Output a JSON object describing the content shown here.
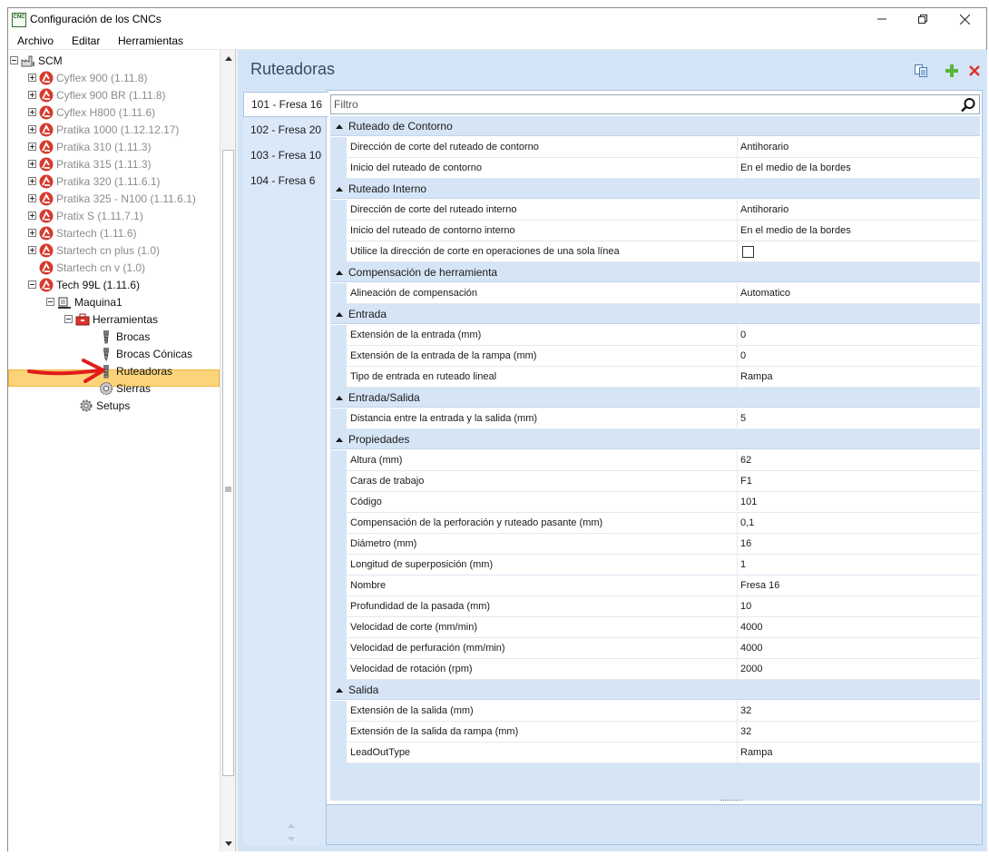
{
  "window": {
    "icon_text": "CNC",
    "title": "Configuración de los CNCs"
  },
  "menu": [
    "Archivo",
    "Editar",
    "Herramientas"
  ],
  "tree": {
    "root": "SCM",
    "machines": [
      {
        "label": "Cyflex 900 (1.11.8)",
        "active": false,
        "expandable": true
      },
      {
        "label": "Cyflex 900 BR (1.11.8)",
        "active": false,
        "expandable": true
      },
      {
        "label": "Cyflex H800 (1.11.6)",
        "active": false,
        "expandable": true
      },
      {
        "label": "Pratika 1000 (1.12.12.17)",
        "active": false,
        "expandable": true
      },
      {
        "label": "Pratika 310 (1.11.3)",
        "active": false,
        "expandable": true
      },
      {
        "label": "Pratika 315 (1.11.3)",
        "active": false,
        "expandable": true
      },
      {
        "label": "Pratika 320 (1.11.6.1)",
        "active": false,
        "expandable": true
      },
      {
        "label": "Pratika 325 - N100 (1.11.6.1)",
        "active": false,
        "expandable": true
      },
      {
        "label": "Pratix S (1.11.7.1)",
        "active": false,
        "expandable": true
      },
      {
        "label": "Startech (1.11.6)",
        "active": false,
        "expandable": true
      },
      {
        "label": "Startech cn plus (1.0)",
        "active": false,
        "expandable": true
      },
      {
        "label": "Startech cn v (1.0)",
        "active": false,
        "expandable": false
      },
      {
        "label": "Tech 99L (1.11.6)",
        "active": true,
        "expandable": true
      }
    ],
    "machine_node": "Maquina1",
    "tools_node": "Herramientas",
    "tool_types": [
      "Brocas",
      "Brocas Cónicas",
      "Ruteadoras",
      "Sierras"
    ],
    "selected": "Ruteadoras",
    "setups": "Setups"
  },
  "panel": {
    "title": "Ruteadoras",
    "toolbar": {
      "copy_icon": "copy-icon",
      "add_icon": "add-icon",
      "delete_icon": "delete-icon"
    },
    "tabs": [
      "101 - Fresa 16",
      "102 - Fresa 20",
      "103 - Fresa 10",
      "104 - Fresa 6"
    ],
    "active_tab": "101 - Fresa 16",
    "filter_placeholder": "Filtro"
  },
  "grid": {
    "categories": [
      {
        "name": "Ruteado de Contorno",
        "props": [
          {
            "name": "Dirección de corte del ruteado de contorno",
            "value": "Antihorario"
          },
          {
            "name": "Inicio del ruteado de contorno",
            "value": "En el medio de la bordes"
          }
        ]
      },
      {
        "name": "Ruteado Interno",
        "props": [
          {
            "name": "Dirección de corte del ruteado interno",
            "value": "Antihorario"
          },
          {
            "name": "Inicio del ruteado de contorno interno",
            "value": "En el medio de la bordes"
          },
          {
            "name": "Utilice la dirección de corte en operaciones de una sola línea",
            "value": "",
            "checkbox": true,
            "checked": false
          }
        ]
      },
      {
        "name": "Compensación de herramienta",
        "props": [
          {
            "name": "Alineación de compensación",
            "value": "Automatico"
          }
        ]
      },
      {
        "name": "Entrada",
        "props": [
          {
            "name": "Extensión de la entrada (mm)",
            "value": "0"
          },
          {
            "name": "Extensión de la entrada de la rampa (mm)",
            "value": "0"
          },
          {
            "name": "Tipo de entrada en ruteado lineal",
            "value": "Rampa"
          }
        ]
      },
      {
        "name": "Entrada/Salida",
        "props": [
          {
            "name": "Distancia entre la entrada y la salida (mm)",
            "value": "5"
          }
        ]
      },
      {
        "name": "Propiedades",
        "props": [
          {
            "name": "Altura (mm)",
            "value": "62"
          },
          {
            "name": "Caras de trabajo",
            "value": "F1"
          },
          {
            "name": "Código",
            "value": "101"
          },
          {
            "name": "Compensación de la perforación y ruteado pasante (mm)",
            "value": "0,1"
          },
          {
            "name": "Diámetro (mm)",
            "value": "16"
          },
          {
            "name": "Longitud de superposición (mm)",
            "value": "1"
          },
          {
            "name": "Nombre",
            "value": "Fresa 16"
          },
          {
            "name": "Profundidad de la pasada (mm)",
            "value": "10"
          },
          {
            "name": "Velocidad de corte (mm/min)",
            "value": "4000"
          },
          {
            "name": "Velocidad de perfuración (mm/min)",
            "value": "4000"
          },
          {
            "name": "Velocidad de rotación (rpm)",
            "value": "2000"
          }
        ]
      },
      {
        "name": "Salida",
        "props": [
          {
            "name": "Extensión de la salida (mm)",
            "value": "32"
          },
          {
            "name": "Extensión de la salida da rampa (mm)",
            "value": "32"
          },
          {
            "name": "LeadOutType",
            "value": "Rampa"
          }
        ]
      }
    ]
  },
  "colors": {
    "accent_red": "#d63a2e",
    "selection": "#fbd47a",
    "panel_bg": "#d4e4f7",
    "category_bg": "#d6e5f6"
  }
}
